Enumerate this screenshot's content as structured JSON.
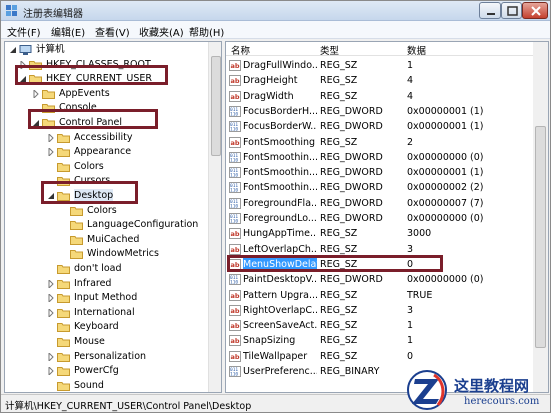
{
  "window": {
    "title": "注册表编辑器",
    "controls": [
      "minimize",
      "maximize",
      "close"
    ]
  },
  "menubar": {
    "items": [
      "文件(F)",
      "编辑(E)",
      "查看(V)",
      "收藏夹(A)",
      "帮助(H)"
    ]
  },
  "tree": {
    "items": [
      {
        "label": "计算机",
        "level": 0,
        "icon": "computer-icon",
        "expander": "open"
      },
      {
        "label": "HKEY_CLASSES_ROOT",
        "level": 1,
        "expander": "closed"
      },
      {
        "label": "HKEY_CURRENT_USER",
        "level": 1,
        "expander": "open"
      },
      {
        "label": "AppEvents",
        "level": 2,
        "expander": "closed"
      },
      {
        "label": "Console",
        "level": 2,
        "expander": "none"
      },
      {
        "label": "Control Panel",
        "level": 2,
        "expander": "open"
      },
      {
        "label": "Accessibility",
        "level": 3,
        "expander": "closed"
      },
      {
        "label": "Appearance",
        "level": 3,
        "expander": "closed"
      },
      {
        "label": "Colors",
        "level": 3,
        "expander": "none"
      },
      {
        "label": "Cursors",
        "level": 3,
        "expander": "none"
      },
      {
        "label": "Desktop",
        "level": 3,
        "expander": "open",
        "selected": true
      },
      {
        "label": "Colors",
        "level": 4,
        "expander": "none"
      },
      {
        "label": "LanguageConfiguration",
        "level": 4,
        "expander": "none"
      },
      {
        "label": "MuiCached",
        "level": 4,
        "expander": "none"
      },
      {
        "label": "WindowMetrics",
        "level": 4,
        "expander": "none"
      },
      {
        "label": "don't load",
        "level": 3,
        "expander": "none"
      },
      {
        "label": "Infrared",
        "level": 3,
        "expander": "closed"
      },
      {
        "label": "Input Method",
        "level": 3,
        "expander": "closed"
      },
      {
        "label": "International",
        "level": 3,
        "expander": "closed"
      },
      {
        "label": "Keyboard",
        "level": 3,
        "expander": "none"
      },
      {
        "label": "Mouse",
        "level": 3,
        "expander": "none"
      },
      {
        "label": "Personalization",
        "level": 3,
        "expander": "closed"
      },
      {
        "label": "PowerCfg",
        "level": 3,
        "expander": "closed"
      },
      {
        "label": "Sound",
        "level": 3,
        "expander": "none"
      }
    ]
  },
  "list": {
    "headers": {
      "name": "名称",
      "type": "类型",
      "data": "数据"
    },
    "rows": [
      {
        "name": "DragFullWindo...",
        "type": "REG_SZ",
        "data": "1",
        "icon": "string"
      },
      {
        "name": "DragHeight",
        "type": "REG_SZ",
        "data": "4",
        "icon": "string"
      },
      {
        "name": "DragWidth",
        "type": "REG_SZ",
        "data": "4",
        "icon": "string"
      },
      {
        "name": "FocusBorderH...",
        "type": "REG_DWORD",
        "data": "0x00000001 (1)",
        "icon": "binary"
      },
      {
        "name": "FocusBorderW...",
        "type": "REG_DWORD",
        "data": "0x00000001 (1)",
        "icon": "binary"
      },
      {
        "name": "FontSmoothing",
        "type": "REG_SZ",
        "data": "2",
        "icon": "string"
      },
      {
        "name": "FontSmoothin...",
        "type": "REG_DWORD",
        "data": "0x00000000 (0)",
        "icon": "binary"
      },
      {
        "name": "FontSmoothin...",
        "type": "REG_DWORD",
        "data": "0x00000001 (1)",
        "icon": "binary"
      },
      {
        "name": "FontSmoothin...",
        "type": "REG_DWORD",
        "data": "0x00000002 (2)",
        "icon": "binary"
      },
      {
        "name": "ForegroundFla...",
        "type": "REG_DWORD",
        "data": "0x00000007 (7)",
        "icon": "binary"
      },
      {
        "name": "ForegroundLo...",
        "type": "REG_DWORD",
        "data": "0x00000000 (0)",
        "icon": "binary"
      },
      {
        "name": "HungAppTime...",
        "type": "REG_SZ",
        "data": "3000",
        "icon": "string"
      },
      {
        "name": "LeftOverlapCh...",
        "type": "REG_SZ",
        "data": "3",
        "icon": "string"
      },
      {
        "name": "MenuShowDelay",
        "type": "REG_SZ",
        "data": "0",
        "icon": "string",
        "selected": true
      },
      {
        "name": "PaintDesktopV...",
        "type": "REG_DWORD",
        "data": "0x00000000 (0)",
        "icon": "binary"
      },
      {
        "name": "Pattern Upgra...",
        "type": "REG_SZ",
        "data": "TRUE",
        "icon": "string"
      },
      {
        "name": "RightOverlapC...",
        "type": "REG_SZ",
        "data": "3",
        "icon": "string"
      },
      {
        "name": "ScreenSaveAct...",
        "type": "REG_SZ",
        "data": "1",
        "icon": "string"
      },
      {
        "name": "SnapSizing",
        "type": "REG_SZ",
        "data": "1",
        "icon": "string"
      },
      {
        "name": "TileWallpaper",
        "type": "REG_SZ",
        "data": "0",
        "icon": "string"
      },
      {
        "name": "UserPreferenc...",
        "type": "REG_BINARY",
        "data": "",
        "icon": "binary"
      }
    ]
  },
  "statusbar": {
    "path": "计算机\\HKEY_CURRENT_USER\\Control Panel\\Desktop"
  },
  "watermark": {
    "cn": "这里教程网",
    "en": "herecours.com"
  },
  "colors": {
    "highlight_box": "#7a1e2a",
    "selection": "#3399ff",
    "watermark": "#1b3f8f"
  }
}
